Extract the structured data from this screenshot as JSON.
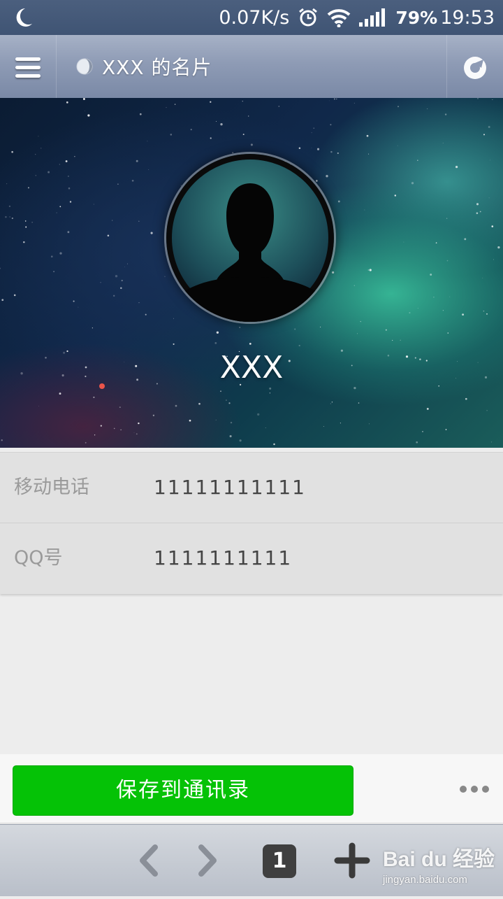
{
  "status_bar": {
    "network_speed": "0.07K/s",
    "battery": "79%",
    "time": "19:53"
  },
  "header": {
    "title": "XXX 的名片"
  },
  "profile": {
    "name": "XXX"
  },
  "info_rows": [
    {
      "label": "移动电话",
      "value": "11111111111"
    },
    {
      "label": "QQ号",
      "value": "1111111111"
    }
  ],
  "actions": {
    "save_label": "保存到通讯录"
  },
  "bottom_nav": {
    "tab_count": "1"
  },
  "watermark": {
    "logo": "Bai du 经验",
    "url": "jingyan.baidu.com"
  },
  "colors": {
    "save_button": "#05c206",
    "header": "#8e9bb5",
    "status_bar": "#435878"
  }
}
